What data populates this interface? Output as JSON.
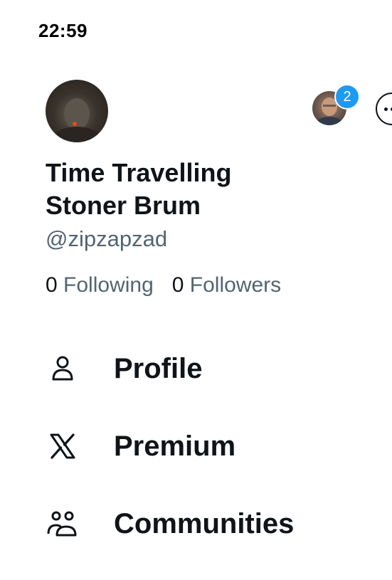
{
  "status_bar": {
    "time": "22:59"
  },
  "header": {
    "avatar_icon": "user-avatar",
    "account_switcher_icon": "secondary-account-avatar",
    "notification_badge": "2",
    "more_icon": "more-options-icon"
  },
  "profile": {
    "display_name": "Time Travelling Stoner Brum",
    "handle": "@zipzapzad",
    "following_count": "0",
    "following_label": "Following",
    "followers_count": "0",
    "followers_label": "Followers"
  },
  "nav": [
    {
      "label": "Profile",
      "icon": "person-icon"
    },
    {
      "label": "Premium",
      "icon": "x-logo-icon"
    },
    {
      "label": "Communities",
      "icon": "communities-icon"
    }
  ],
  "colors": {
    "accent": "#1d9bf0",
    "secondary_text": "#536471",
    "primary_text": "#0f1419"
  }
}
